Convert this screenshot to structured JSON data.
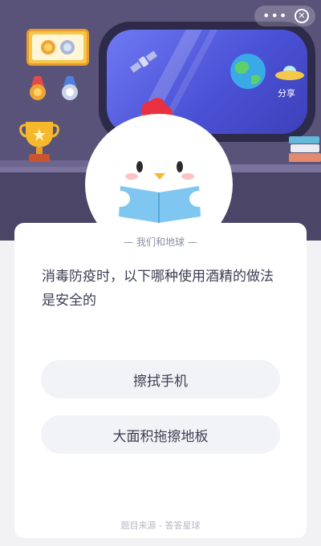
{
  "header": {
    "more_icon": "more-dots-icon",
    "close_icon": "close-icon",
    "share_label": "分享"
  },
  "quiz": {
    "subject": "— 我们和地球 —",
    "question": "消毒防疫时，以下哪种使用酒精的做法是安全的",
    "options": [
      "擦拭手机",
      "大面积拖擦地板"
    ],
    "source": "题目来源 - 答答星球"
  },
  "colors": {
    "scene_bg": "#5a5379",
    "window_blue": "#4b52d6",
    "chicken_comb": "#e8303e",
    "book_blue": "#7fc7f0",
    "card_bg": "#ffffff",
    "option_bg": "#f2f3f7"
  }
}
